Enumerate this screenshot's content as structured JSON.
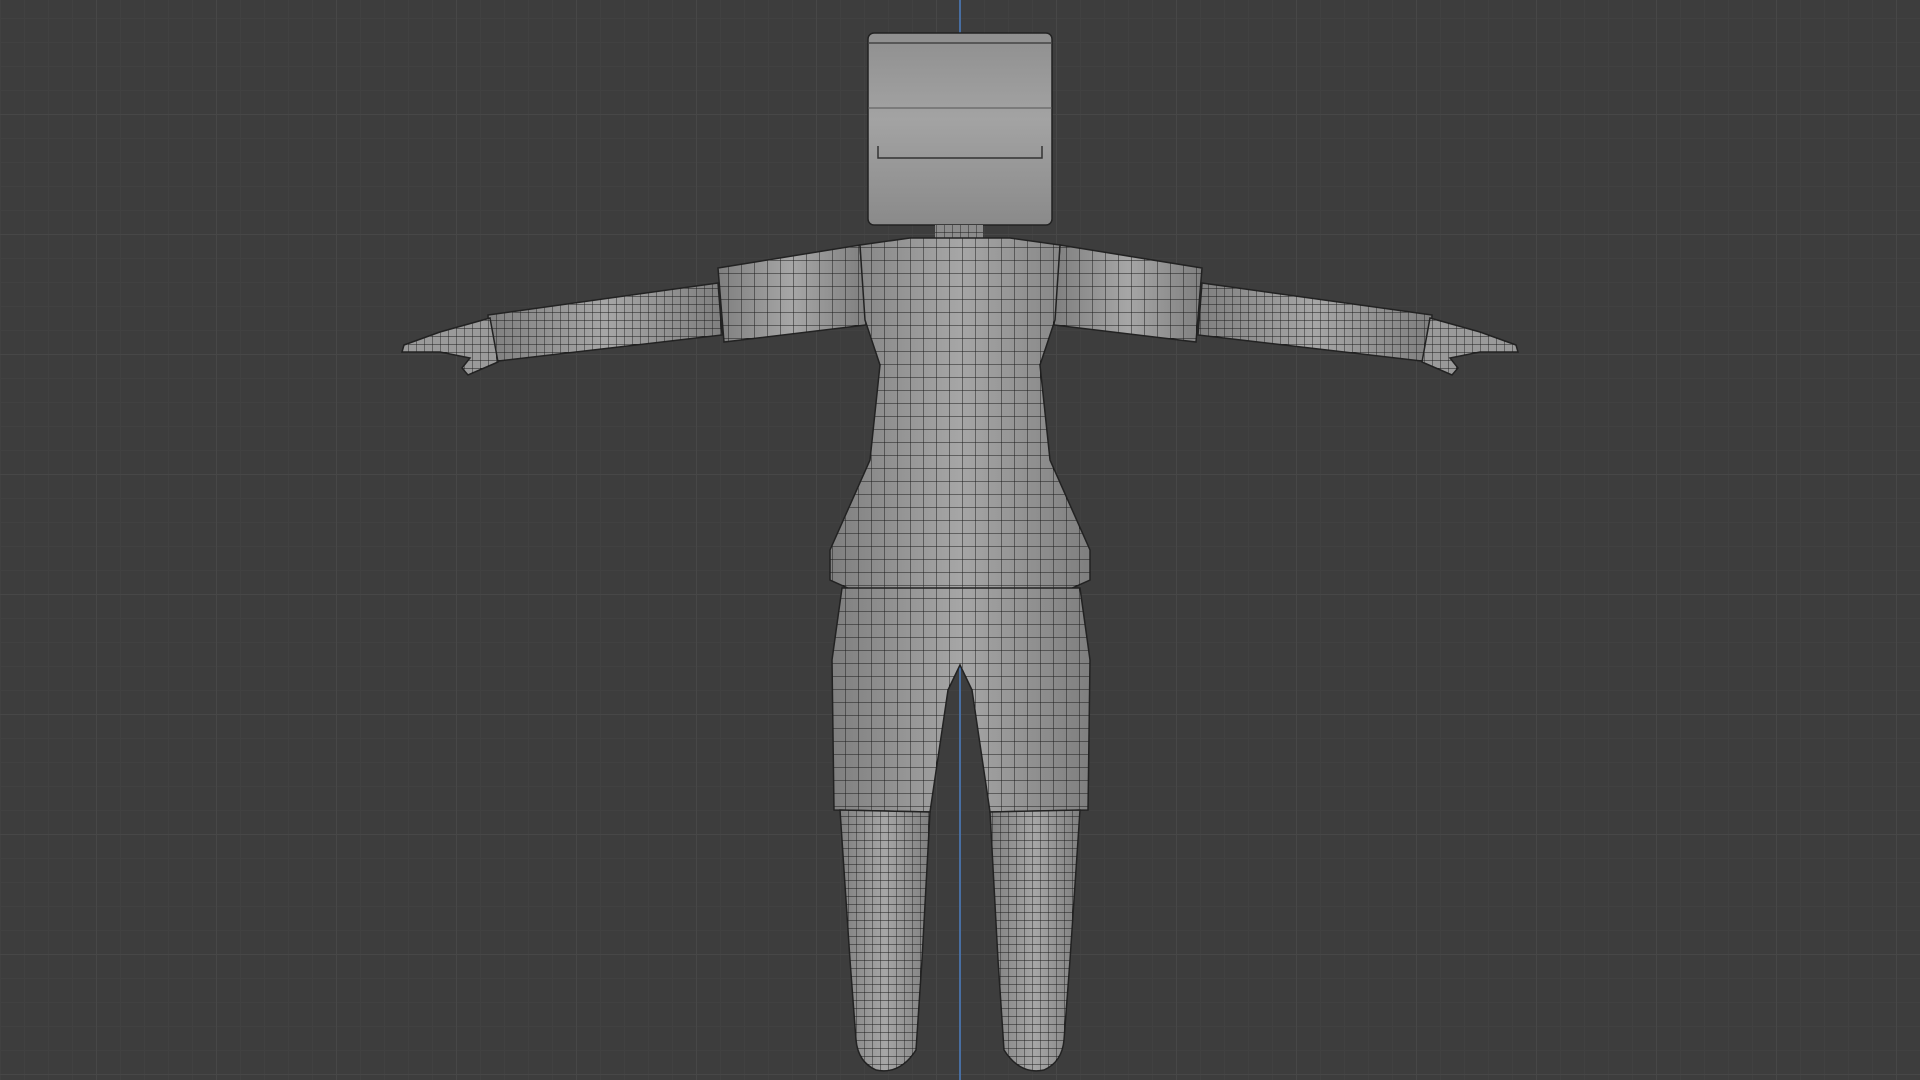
{
  "viewport": {
    "background": "#3d3d3d",
    "grid_major_color": "#474747",
    "grid_minor_color": "#414141",
    "axis_color": "#4a77b3"
  },
  "model": {
    "shading": "solid-with-wireframe",
    "mesh_color": "#9a9a9a",
    "wire_color": "#1c1c1c",
    "pose": "T-pose",
    "parts": [
      "head",
      "neck",
      "torso",
      "left-arm",
      "right-arm",
      "left-hand",
      "right-hand",
      "shorts",
      "left-leg",
      "right-leg"
    ]
  }
}
